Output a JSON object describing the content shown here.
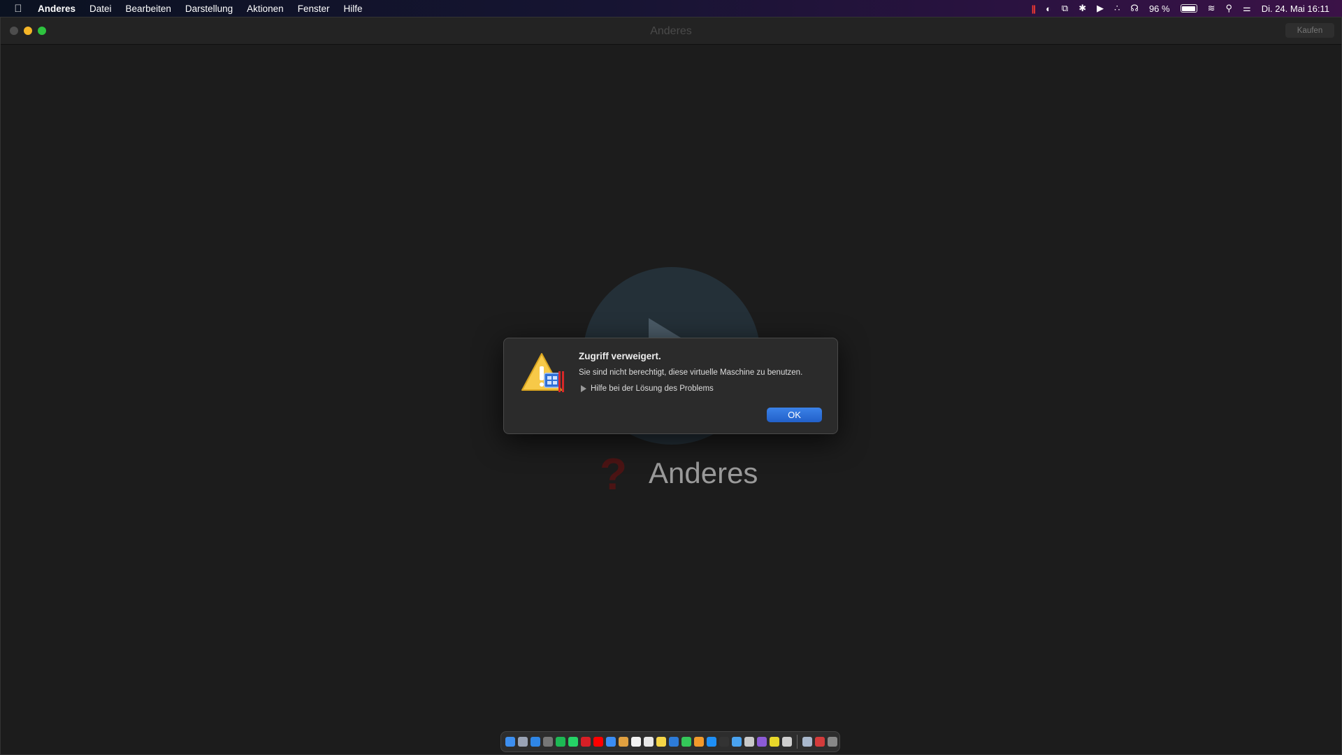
{
  "menubar": {
    "app_name": "Anderes",
    "menus": [
      "Datei",
      "Bearbeiten",
      "Darstellung",
      "Aktionen",
      "Fenster",
      "Hilfe"
    ],
    "battery": "96 %",
    "datetime": "Di. 24. Mai 16:11"
  },
  "window": {
    "title": "Anderes",
    "buy_label": "Kaufen"
  },
  "vm": {
    "name": "Anderes",
    "os_glyph": "?"
  },
  "dialog": {
    "title": "Zugriff verweigert.",
    "message": "Sie sind nicht berechtigt, diese virtuelle Maschine zu benutzen.",
    "help_label": "Hilfe bei der Lösung des Problems",
    "ok_label": "OK"
  },
  "colors": {
    "accent": "#2a6fdb",
    "minimize": "#f5b527",
    "maximize": "#2ec33f"
  },
  "dock": {
    "icons": [
      {
        "name": "finder-icon",
        "color": "#3d8ff0"
      },
      {
        "name": "launchpad-icon",
        "color": "#9aa3b5"
      },
      {
        "name": "safari-icon",
        "color": "#2f86e6"
      },
      {
        "name": "system-prefs-icon",
        "color": "#777"
      },
      {
        "name": "spotify-icon",
        "color": "#1db954"
      },
      {
        "name": "whatsapp-icon",
        "color": "#25d366"
      },
      {
        "name": "netflix-icon",
        "color": "#d81f26"
      },
      {
        "name": "youtube-icon",
        "color": "#ff0000"
      },
      {
        "name": "mail-icon",
        "color": "#3a8df5"
      },
      {
        "name": "photos-icon",
        "color": "#e0a040"
      },
      {
        "name": "calendar-icon",
        "color": "#f2f2f2"
      },
      {
        "name": "reminders-icon",
        "color": "#e8e8e8"
      },
      {
        "name": "notes-icon",
        "color": "#f5d547"
      },
      {
        "name": "keynote-icon",
        "color": "#2d7bd8"
      },
      {
        "name": "messages-icon",
        "color": "#34c759"
      },
      {
        "name": "pages-icon",
        "color": "#f39a2b"
      },
      {
        "name": "appstore-icon",
        "color": "#1e8ff5"
      },
      {
        "name": "terminal-icon",
        "color": "#333"
      },
      {
        "name": "xcode-icon",
        "color": "#4aa3f0"
      },
      {
        "name": "pen-tool-icon",
        "color": "#c9c9c9"
      },
      {
        "name": "star-app-icon",
        "color": "#8c5bd6"
      },
      {
        "name": "zeplin-icon",
        "color": "#e8d72a"
      },
      {
        "name": "parallels-app-icon",
        "color": "#cfcfcf"
      }
    ],
    "recent": [
      {
        "name": "finder-window-icon",
        "color": "#a9b8cc"
      },
      {
        "name": "parallels-vm-icon",
        "color": "#d33b3b"
      },
      {
        "name": "trash-icon",
        "color": "#888"
      }
    ]
  }
}
